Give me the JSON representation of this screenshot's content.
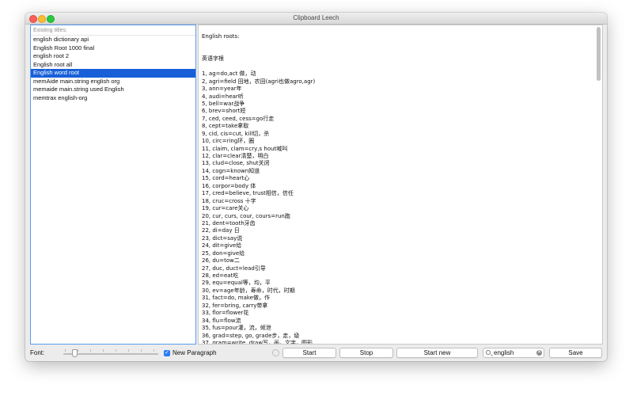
{
  "window": {
    "title": "Clipboard Leech"
  },
  "titles_list": {
    "header": "Existing titles:",
    "items": [
      "english dictionary api",
      "English Root 1000 final",
      "english root 2",
      "English root all",
      "English word root",
      "memAide main.string english org",
      "memaide main.string used English",
      "memtrax english-org"
    ],
    "selected_index": 4
  },
  "document": {
    "lines": [
      "English roots:",
      "",
      "",
      "英语字根",
      "",
      "1, ag=do,act 做，动",
      "2, agri=field 田地，农田(agri也做agro,agr)",
      "3, ann=year年",
      "4, audi=hear听",
      "5, bell=war战争",
      "6, brev=short短",
      "7, ced, ceed, cess=go行走",
      "8, cept=take拿取",
      "9, cid, cis=cut, kill切，杀",
      "10, circ=ring环，圈",
      "11, claim, clam=cry,s hout喊叫",
      "12, clar=clear清楚，明白",
      "13, clud=close, shut关闭",
      "14, cogn=known知道",
      "15, cord=heart心",
      "16, corpor=body 体",
      "17, cred=believe, trust相信，信任",
      "18, cruc=cross 十字",
      "19, cur=care关心",
      "20, cur, curs, cour, cours=run跑",
      "21, dent=tooth牙齿",
      "22, di=day 日",
      "23, dict=say说",
      "24, dit=give给",
      "25, don=give给",
      "26, du=tow二",
      "27, duc, duct=lead引导",
      "28, ed=eat吃",
      "29, equ=equal等，均，平",
      "30, ev=age年龄，寿命，时代，时期",
      "31, fact=do, make做，作",
      "32, fer=bring, carry带拿",
      "33, flor=flower花",
      "34, flu=flow流",
      "35, fus=pour灌，流，倾泄",
      "36, grad=step, go, grade步，走，级",
      "37, gram=write, draw写，画，文字，图形"
    ]
  },
  "bottom_bar": {
    "font_label": "Font:",
    "new_paragraph_label": "New Paragraph",
    "new_paragraph_checked": true,
    "font_size_level": 0.1,
    "start_button": "Start",
    "stop_button": "Stop",
    "start_new_button": "Start new",
    "search_value": "english",
    "save_button": "Save"
  },
  "colors": {
    "selection": "#1860d8",
    "focus_ring": "#5a9cf0",
    "checkbox": "#2a7df5"
  }
}
